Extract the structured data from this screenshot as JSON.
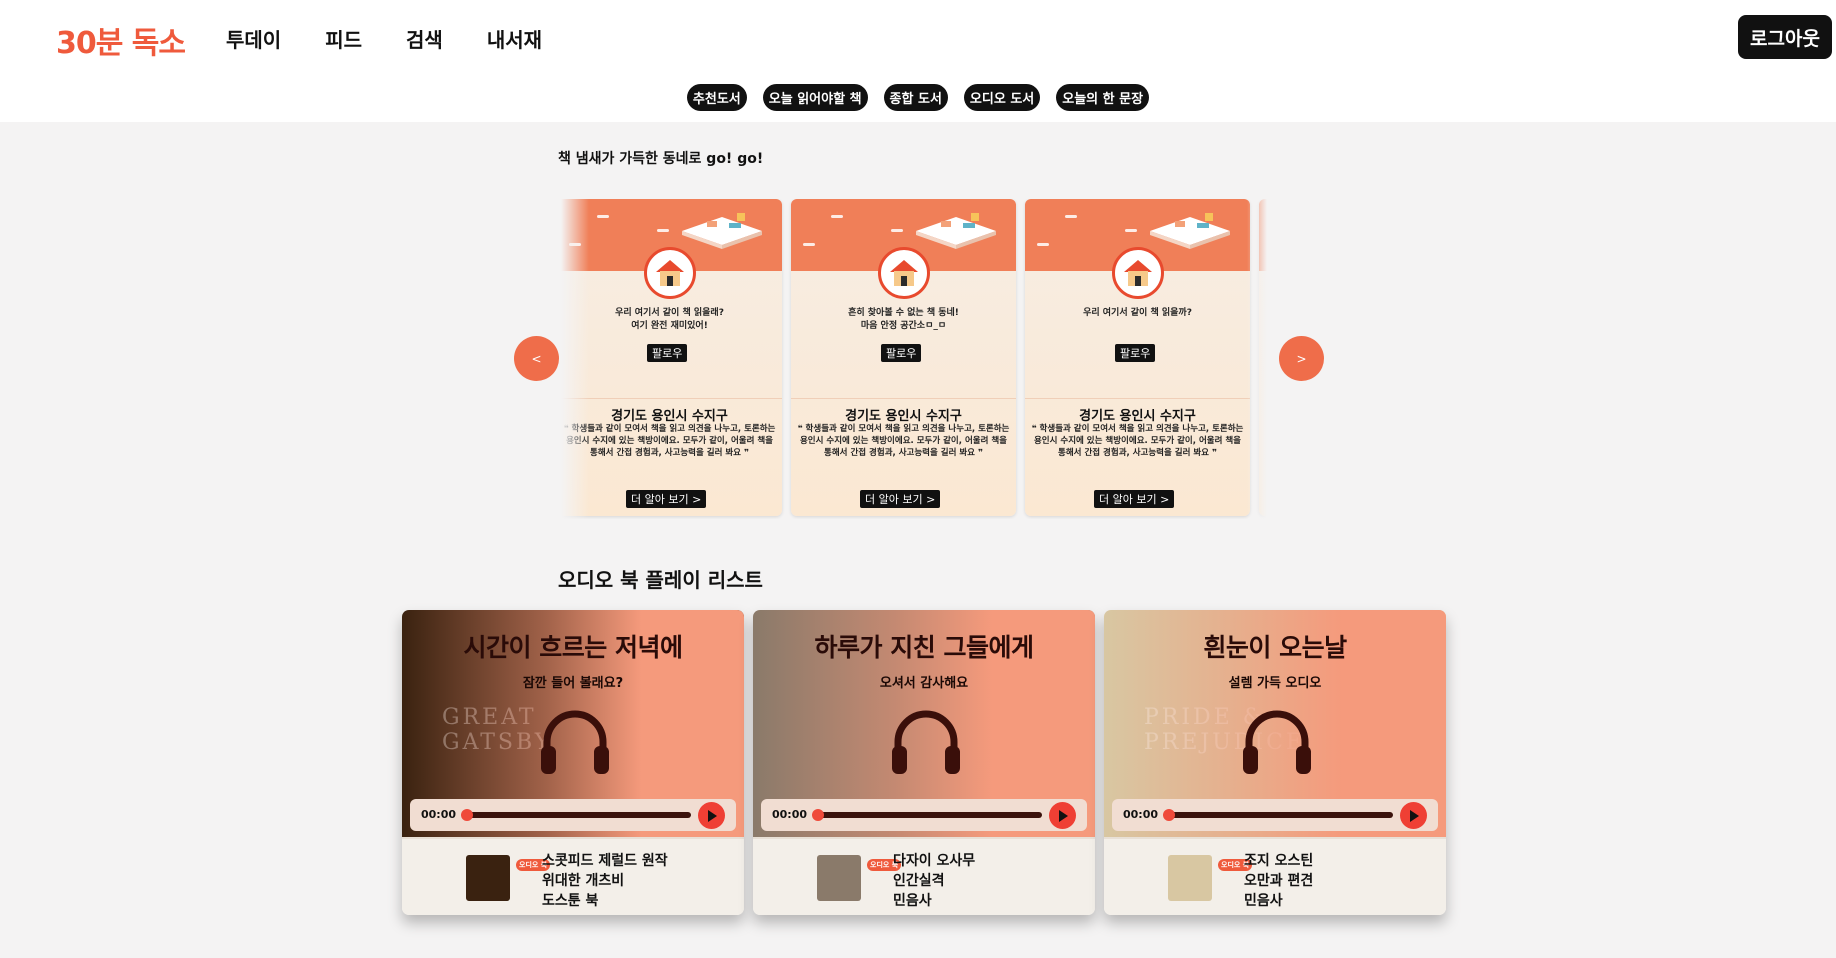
{
  "header": {
    "logo": "30분 독소",
    "nav": [
      "투데이",
      "피드",
      "검색",
      "내서재"
    ],
    "logout_label": "로그아웃",
    "subnav": [
      "추천도서",
      "오늘 읽어야할 책",
      "종합 도서",
      "오디오 도서",
      "오늘의 한 문장"
    ]
  },
  "community": {
    "subtitle": "책 냄새가 가득한 동네로 go! go!",
    "prev_label": "<",
    "next_label": ">",
    "cards": [
      {
        "desc": "우리 여기서 같이 책 읽을래?\n여기 완전 재미있어!",
        "follow_label": "팔로우",
        "location": "경기도 용인시 수지구",
        "quote": "❝ 학생들과 같이 모여서 책을 읽고 의견을 나누고, 토론하는 용인시 수지에 있는 책방이에요. 모두가 같이, 어울려 책을 통해서 간접 경험과, 사고능력을 길러 봐요 ❞",
        "more_label": "더 알아 보기 >"
      },
      {
        "desc": "흔히 찾아볼 수 없는 책 동네!\n마음 안정 공간소ㅁ_ㅁ",
        "follow_label": "팔로우",
        "location": "경기도 용인시 수지구",
        "quote": "❝ 학생들과 같이 모여서 책을 읽고 의견을 나누고, 토론하는 용인시 수지에 있는 책방이에요. 모두가 같이, 어울려 책을 통해서 간접 경험과, 사고능력을 길러 봐요 ❞",
        "more_label": "더 알아 보기 >"
      },
      {
        "desc": "우리 여기서 같이 책 읽을까?",
        "follow_label": "팔로우",
        "location": "경기도 용인시 수지구",
        "quote": "❝ 학생들과 같이 모여서 책을 읽고 의견을 나누고, 토론하는 용인시 수지에 있는 책방이에요. 모두가 같이, 어울려 책을 통해서 간접 경험과, 사고능력을 길러 봐요 ❞",
        "more_label": "더 알아 보기 >"
      }
    ]
  },
  "audio": {
    "title": "오디오 북 플레이 리스트",
    "cards": [
      {
        "title": "시간이 흐르는 저녁에",
        "subtitle": "잠깐 들어 볼래요?",
        "time": "00:00",
        "badge": "오디오 북",
        "author": "스콧피드 제럴드 원작",
        "book": "위대한 개츠비",
        "publisher": "도스툰 북",
        "bg_color": "#3a2210",
        "hero_art_text": "GREAT GATSBY"
      },
      {
        "title": "하루가 지친 그들에게",
        "subtitle": "오셔서 감사해요",
        "time": "00:00",
        "badge": "오디오 북",
        "author": "다자이 오사무",
        "book": "인간실격",
        "publisher": "민음사",
        "bg_color": "#8a7a6a",
        "hero_art_text": ""
      },
      {
        "title": "흰눈이 오는날",
        "subtitle": "설렘 가득 오디오",
        "time": "00:00",
        "badge": "오디오 북",
        "author": "조지 오스틴",
        "book": "오만과 편견",
        "publisher": "민음사",
        "bg_color": "#d8c7a2",
        "hero_art_text": "PRIDE & PREJUDICE"
      }
    ]
  },
  "colors": {
    "accent": "#ef5a3c",
    "dark": "#111111",
    "audio_peach": "#f59a7c"
  }
}
